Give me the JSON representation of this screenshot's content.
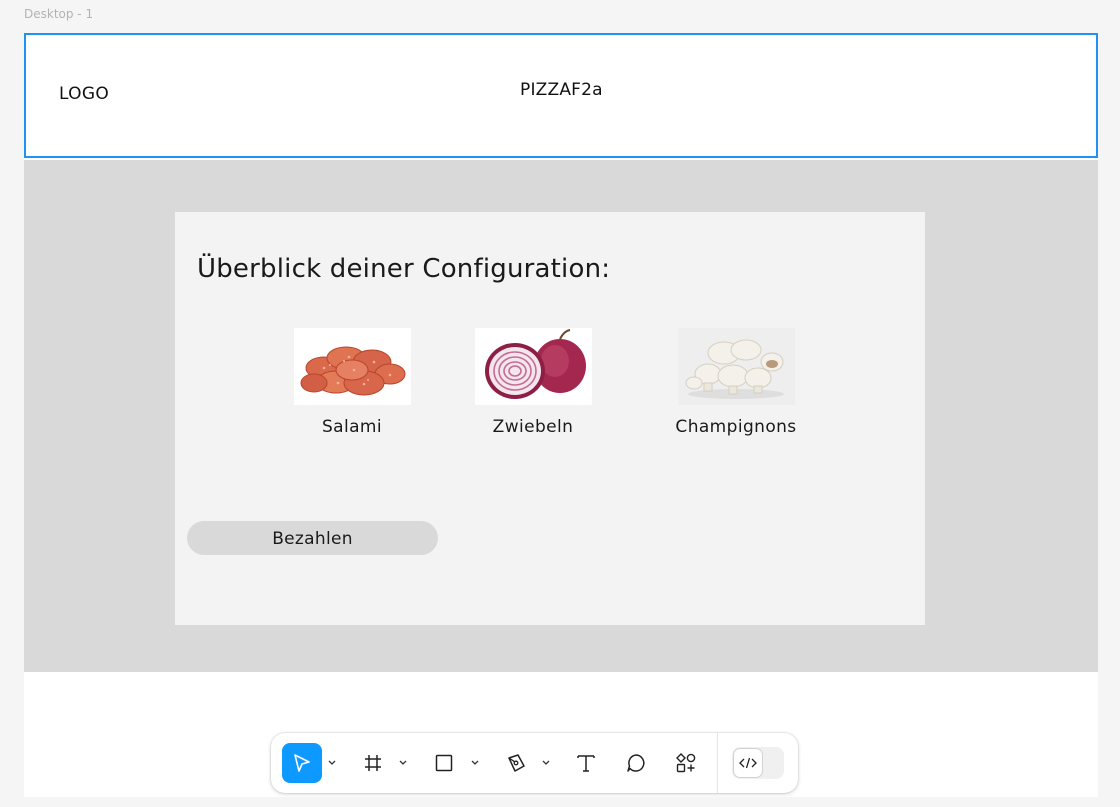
{
  "canvas": {
    "frame_label": "Desktop - 1"
  },
  "header": {
    "logo": "LOGO",
    "brand": "PIZZAF2a"
  },
  "overview": {
    "title": "Überblick deiner Configuration:",
    "toppings": [
      {
        "label": "Salami",
        "icon": "salami-image"
      },
      {
        "label": "Zwiebeln",
        "icon": "onion-image"
      },
      {
        "label": "Champignons",
        "icon": "mushroom-image"
      }
    ],
    "pay_button": "Bezahlen"
  },
  "toolbar": {
    "tools": [
      "move-tool",
      "frame-tool",
      "rectangle-tool",
      "pen-tool",
      "text-tool",
      "comment-tool",
      "actions-tool"
    ],
    "active_tool": "move-tool",
    "dev_mode_icon": "code-icon",
    "accent_color": "#0d99ff"
  },
  "colors": {
    "selection": "#1f93f5",
    "band": "#d9d9d9",
    "card": "#f3f3f3"
  }
}
